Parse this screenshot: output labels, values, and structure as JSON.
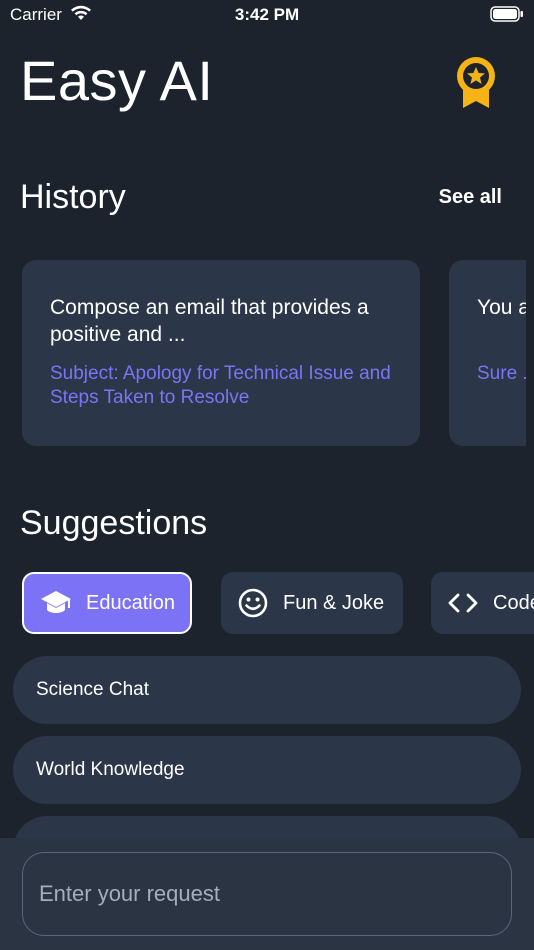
{
  "status_bar": {
    "carrier": "Carrier",
    "time": "3:42 PM"
  },
  "header": {
    "title": "Easy AI",
    "award_icon": "award-ribbon-icon",
    "award_color": "#f5b316"
  },
  "history": {
    "title": "History",
    "see_all": "See all",
    "cards": [
      {
        "prompt": "Compose an email that provides a positive and ...",
        "response": "Subject: Apology for Technical Issue and Steps Taken to Resolve"
      },
      {
        "prompt": "You a... Resp...",
        "response": "Sure ... be he..."
      }
    ]
  },
  "suggestions": {
    "title": "Suggestions",
    "chips": [
      {
        "label": "Education",
        "icon": "graduation-cap-icon",
        "selected": true
      },
      {
        "label": "Fun & Joke",
        "icon": "smiley-icon",
        "selected": false
      },
      {
        "label": "Code",
        "icon": "code-brackets-icon",
        "selected": false
      }
    ],
    "items": [
      {
        "label": "Science Chat"
      },
      {
        "label": "World Knowledge"
      },
      {
        "label": ""
      }
    ]
  },
  "input": {
    "placeholder": "Enter your request",
    "value": ""
  },
  "colors": {
    "background": "#1d232c",
    "card": "#2b3648",
    "accent": "#7b72f6",
    "response_text": "#7c74f4"
  }
}
